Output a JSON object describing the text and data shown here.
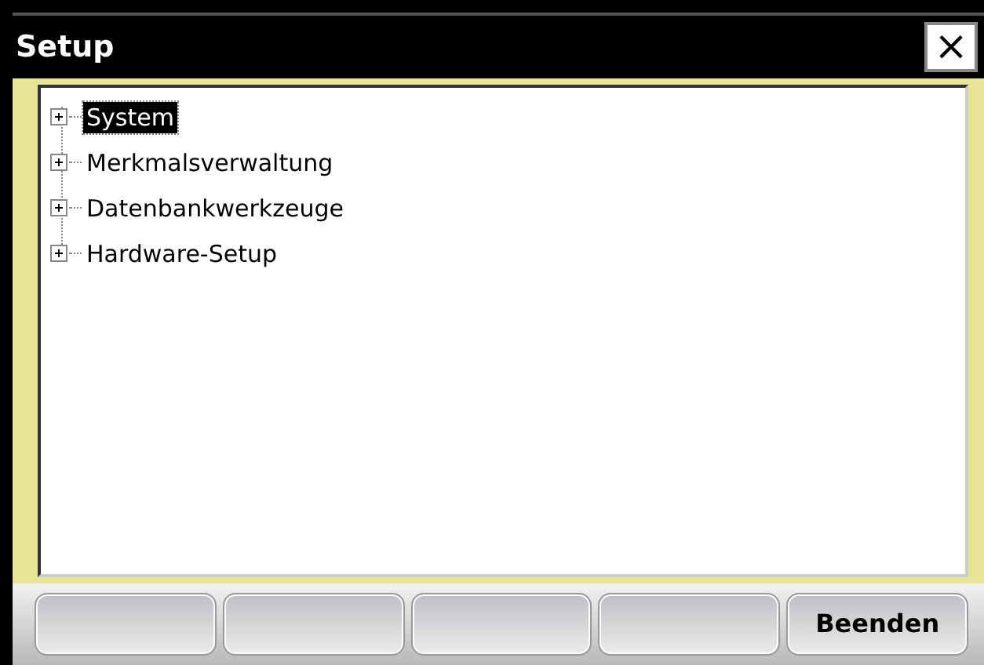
{
  "window": {
    "title": "Setup",
    "close": "×"
  },
  "tree": {
    "items": [
      {
        "label": "System",
        "selected": true,
        "expanded": false
      },
      {
        "label": "Merkmalsverwaltung",
        "selected": false,
        "expanded": false
      },
      {
        "label": "Datenbankwerkzeuge",
        "selected": false,
        "expanded": false
      },
      {
        "label": "Hardware-Setup",
        "selected": false,
        "expanded": false
      }
    ]
  },
  "buttons": [
    {
      "kind": "blank"
    },
    {
      "kind": "blank"
    },
    {
      "kind": "blank"
    },
    {
      "kind": "blank"
    },
    {
      "kind": "labeled",
      "label": "Beenden"
    }
  ]
}
